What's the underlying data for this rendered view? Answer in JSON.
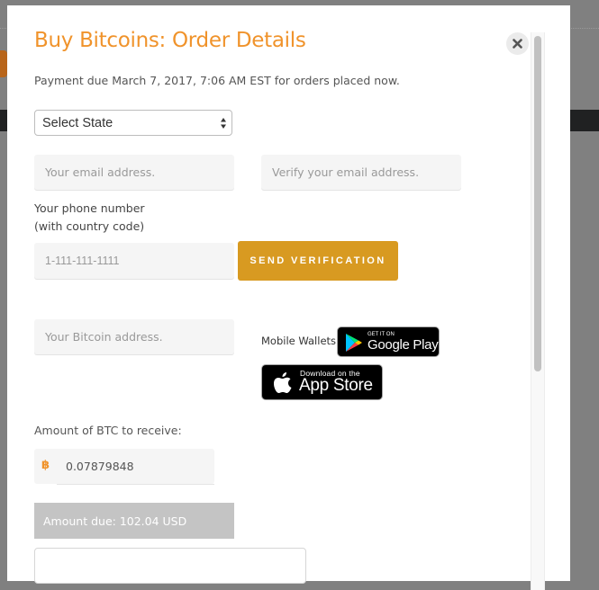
{
  "modal": {
    "title": "Buy Bitcoins: Order Details",
    "subtitle": "Payment due March 7, 2017, 7:06 AM EST for orders placed now.",
    "close_icon": "close-icon"
  },
  "form": {
    "state_select": {
      "selected": "Select State"
    },
    "email": {
      "placeholder": "Your email address."
    },
    "verify_email": {
      "placeholder": "Verify your email address."
    },
    "phone_label_line1": "Your phone number",
    "phone_label_line2": "(with country code)",
    "phone": {
      "placeholder": "1-111-111-1111"
    },
    "send_verification_label": "SEND VERIFICATION",
    "bitcoin_address": {
      "placeholder": "Your Bitcoin address."
    },
    "mobile_wallets_label": "Mobile Wallets:",
    "google_play": {
      "small": "GET IT ON",
      "big": "Google Play"
    },
    "app_store": {
      "small": "Download on the",
      "big": "App Store"
    },
    "amount_label": "Amount of BTC to receive:",
    "btc_symbol": "฿",
    "btc_amount": "0.07879848",
    "amount_due": "Amount due: 102.04 USD"
  },
  "colors": {
    "accent": "#F0932B",
    "button": "#D89A21",
    "amount_due_bg": "#C4C4C4",
    "overlay": "#808080"
  }
}
